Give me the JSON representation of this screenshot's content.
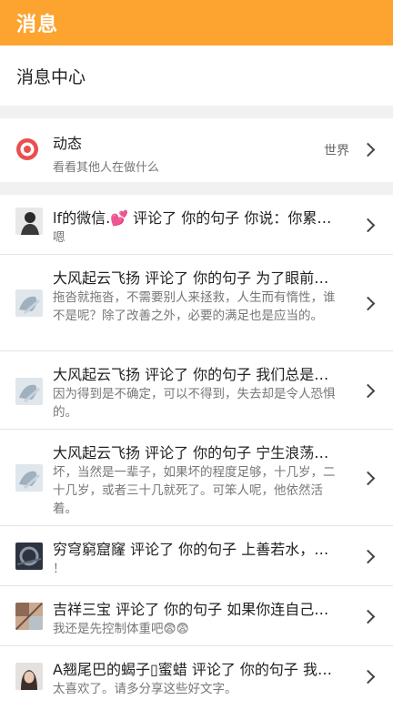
{
  "appbar": {
    "title": "消息"
  },
  "section": {
    "title": "消息中心"
  },
  "dynamic": {
    "title": "动态",
    "subtitle": "看看其他人在做什么",
    "right_label": "世界"
  },
  "messages": [
    {
      "header": "lf的微信.💕 评论了 你的句子 你说：你累…",
      "body": "嗯"
    },
    {
      "header": "大风起云飞扬 评论了 你的句子 为了眼前…",
      "body": "拖沓就拖沓，不需要别人来拯救，人生而有惰性，谁不是呢？除了改善之外，必要的满足也是应当的。"
    },
    {
      "header": "大风起云飞扬 评论了 你的句子 我们总是…",
      "body": "因为得到是不确定，可以不得到，失去却是令人恐惧的。"
    },
    {
      "header": "大风起云飞扬 评论了 你的句子 宁生浪荡…",
      "body": "坏，当然是一辈子，如果坏的程度足够，十几岁，二十几岁，或者三十几就死了。可笨人呢，他依然活着。"
    },
    {
      "header": "穷穹窮窟窿 评论了 你的句子 上善若水，…",
      "body": "！"
    },
    {
      "header": "吉祥三宝 评论了 你的句子 如果你连自己…",
      "body": "我还是先控制体重吧😨😨"
    },
    {
      "header": "A翘尾巴的蝎子▯蜜蜡 评论了 你的句子 我…",
      "body": "太喜欢了。请多分享这些好文字。"
    }
  ]
}
